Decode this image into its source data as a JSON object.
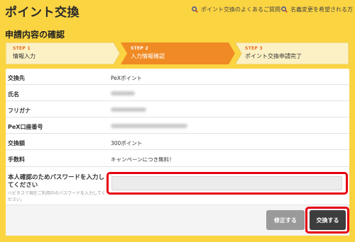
{
  "header": {
    "title": "ポイント交換",
    "faq_link": "ポイント交換のよくあるご質問",
    "rename_link": "名義変更を希望される方"
  },
  "section_title": "申請内容の確認",
  "steps": [
    {
      "num": "STEP 1",
      "label": "情報入力"
    },
    {
      "num": "STEP 2",
      "label": "入力情報確認"
    },
    {
      "num": "STEP 3",
      "label": "ポイント交換申請完了"
    }
  ],
  "form": {
    "destination": {
      "label": "交換先",
      "value": "PeXポイント"
    },
    "name": {
      "label": "氏名"
    },
    "furigana": {
      "label": "フリガナ"
    },
    "pex_account": {
      "label": "PeX口座番号"
    },
    "amount": {
      "label": "交換額",
      "value": "300ポイント"
    },
    "fee": {
      "label": "手数料",
      "value": "キャンペーンにつき無料！"
    },
    "password": {
      "label": "本人確認のためパスワードを入力してください",
      "hint": "ハピタスで現在ご利用中のパスワードを入力してください。",
      "value": ""
    }
  },
  "buttons": {
    "fix": "修正する",
    "exchange": "交換する"
  },
  "colors": {
    "background": "#fbd442",
    "active_step": "#f08a24",
    "highlight": "#e60012"
  }
}
